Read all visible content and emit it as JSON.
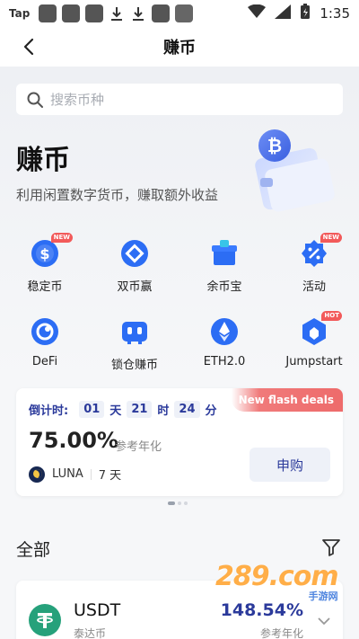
{
  "status_bar": {
    "carrier": "Tap",
    "time": "1:35"
  },
  "header": {
    "title": "赚币"
  },
  "search": {
    "placeholder": "搜索币种"
  },
  "hero": {
    "title": "赚币",
    "subtitle": "利用闲置数字货币，赚取额外收益"
  },
  "grid": [
    {
      "label": "稳定币",
      "icon": "dollar-icon",
      "badge": "NEW"
    },
    {
      "label": "双币赢",
      "icon": "diamond-icon",
      "badge": ""
    },
    {
      "label": "余币宝",
      "icon": "box-icon",
      "badge": ""
    },
    {
      "label": "活动",
      "icon": "percent-icon",
      "badge": "NEW"
    },
    {
      "label": "DeFi",
      "icon": "defi-icon",
      "badge": ""
    },
    {
      "label": "锁仓赚币",
      "icon": "lock-icon",
      "badge": ""
    },
    {
      "label": "ETH2.0",
      "icon": "eth-icon",
      "badge": ""
    },
    {
      "label": "Jumpstart",
      "icon": "jumpstart-icon",
      "badge": "HOT"
    }
  ],
  "deal": {
    "ribbon": "New flash deals",
    "countdown_label": "倒计时:",
    "days": "01",
    "day_unit": "天",
    "hours": "21",
    "hour_unit": "时",
    "minutes": "24",
    "minute_unit": "分",
    "rate": "75.00%",
    "rate_label": "参考年化",
    "coin": "LUNA",
    "term": "7 天",
    "button": "申购"
  },
  "section": {
    "title": "全部"
  },
  "asset": {
    "name": "USDT",
    "sub": "泰达币",
    "rate": "148.54%",
    "rate_label": "参考年化"
  },
  "watermark": {
    "text": "289.com",
    "sub": "手游网"
  },
  "colors": {
    "accent": "#2b3a9b",
    "icon_blue": "#2c6df4",
    "ribbon": "#ee6b6b",
    "usdt": "#26a17b"
  }
}
